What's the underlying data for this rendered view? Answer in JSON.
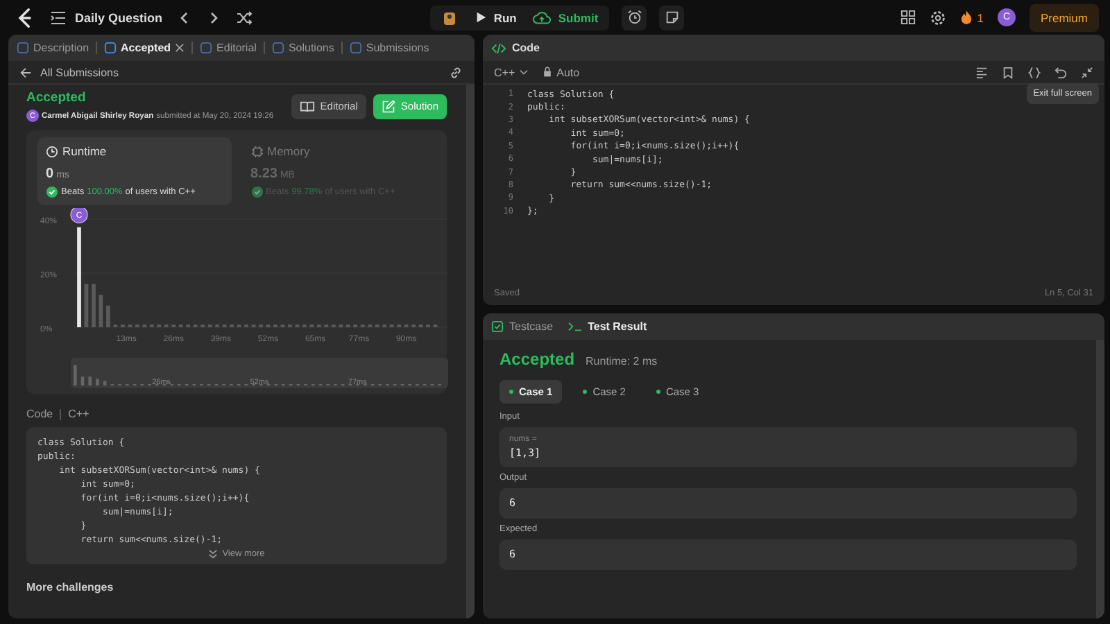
{
  "topbar": {
    "title": "Daily Question",
    "run": "Run",
    "submit": "Submit",
    "streak": "1",
    "avatar": "C",
    "premium": "Premium"
  },
  "left_tabs": [
    {
      "label": "Description",
      "selected": false,
      "closable": false
    },
    {
      "label": "Accepted",
      "selected": true,
      "closable": true
    },
    {
      "label": "Editorial",
      "selected": false,
      "closable": false
    },
    {
      "label": "Solutions",
      "selected": false,
      "closable": false
    },
    {
      "label": "Submissions",
      "selected": false,
      "closable": false
    }
  ],
  "back_link": "All Submissions",
  "submission": {
    "status": "Accepted",
    "avatar": "C",
    "author": "Carmel Abigail Shirley Royan",
    "submitted": "submitted at May 20, 2024 19:26",
    "buttons": [
      {
        "label": "Editorial",
        "kind": "secondary"
      },
      {
        "label": "Solution",
        "kind": "primary"
      }
    ]
  },
  "metrics": [
    {
      "title": "Runtime",
      "value": "0",
      "unit": "ms",
      "beats_label": "Beats",
      "beats": "100.00%",
      "beats_suffix": "of users with C++",
      "selected": true,
      "kind": "clock"
    },
    {
      "title": "Memory",
      "value": "8.23",
      "unit": "MB",
      "beats_label": "Beats",
      "beats": "99.78%",
      "beats_suffix": "of users with C++",
      "selected": false,
      "kind": "chip"
    }
  ],
  "distribution": {
    "marker_initial": "C",
    "chart_data": {
      "type": "bar",
      "x": [
        0,
        2,
        4,
        6,
        8,
        10,
        12,
        14,
        16,
        18,
        20,
        22,
        24,
        26,
        28,
        30,
        32,
        34,
        36,
        38,
        40,
        42,
        44,
        46,
        48,
        50,
        52,
        54,
        56,
        58,
        60,
        62,
        64,
        66,
        68,
        70,
        72,
        74,
        76,
        78,
        80,
        82,
        84,
        86,
        88,
        90,
        92,
        94,
        96,
        98
      ],
      "values": [
        37,
        16,
        16,
        12,
        8,
        1,
        1,
        1,
        1,
        1,
        1,
        1,
        1,
        1,
        1,
        1,
        1,
        1,
        1,
        1,
        1,
        1,
        1,
        1,
        1,
        1,
        1,
        1,
        1,
        1,
        1,
        1,
        1,
        1,
        1,
        1,
        1,
        1,
        1,
        1,
        1,
        1,
        1,
        1,
        1,
        1,
        1,
        1,
        1,
        1
      ],
      "xlim": [
        0,
        100
      ],
      "ylim": [
        0,
        40
      ],
      "yticks": [
        {
          "value": 0,
          "label": "0%"
        },
        {
          "value": 20,
          "label": "20%"
        },
        {
          "value": 40,
          "label": "40%"
        }
      ],
      "xticks": [
        {
          "value": 13,
          "label": "13ms"
        },
        {
          "value": 26,
          "label": "26ms"
        },
        {
          "value": 39,
          "label": "39ms"
        },
        {
          "value": 52,
          "label": "52ms"
        },
        {
          "value": 65,
          "label": "65ms"
        },
        {
          "value": 77,
          "label": "77ms"
        },
        {
          "value": 90,
          "label": "90ms"
        }
      ]
    },
    "overview_labels": [
      "26ms",
      "52ms",
      "77ms"
    ]
  },
  "code_section": {
    "title": "Code",
    "language": "C++",
    "lines": [
      "class Solution {",
      "public:",
      "    int subsetXORSum(vector<int>& nums) {",
      "        int sum=0;",
      "        for(int i=0;i<nums.size();i++){",
      "            sum|=nums[i];",
      "        }",
      "        return sum<<nums.size()-1;"
    ],
    "view_more": "View more"
  },
  "more_challenges": "More challenges",
  "editor": {
    "title": "Code",
    "language": "C++",
    "mode": "Auto",
    "tooltip": "Exit full screen",
    "lines": [
      {
        "number": "1",
        "text": "class Solution {"
      },
      {
        "number": "2",
        "text": "public:"
      },
      {
        "number": "3",
        "text": "    int subsetXORSum(vector<int>& nums) {"
      },
      {
        "number": "4",
        "text": "        int sum=0;"
      },
      {
        "number": "5",
        "text": "        for(int i=0;i<nums.size();i++){"
      },
      {
        "number": "6",
        "text": "            sum|=nums[i];"
      },
      {
        "number": "7",
        "text": "        }"
      },
      {
        "number": "8",
        "text": "        return sum<<nums.size()-1;"
      },
      {
        "number": "9",
        "text": "    }"
      },
      {
        "number": "10",
        "text": "};"
      }
    ],
    "status": "Saved",
    "cursor": "Ln 5, Col 31"
  },
  "result_tabs": [
    {
      "label": "Testcase",
      "selected": false
    },
    {
      "label": "Test Result",
      "selected": true
    }
  ],
  "result": {
    "status": "Accepted",
    "runtime": "Runtime: 2 ms",
    "cases": [
      {
        "label": "Case 1",
        "selected": true
      },
      {
        "label": "Case 2",
        "selected": false
      },
      {
        "label": "Case 3",
        "selected": false
      }
    ],
    "input_label": "Input",
    "input_name": "nums =",
    "input_value": "[1,3]",
    "output_label": "Output",
    "output_value": "6",
    "expected_label": "Expected",
    "expected_value": "6"
  }
}
